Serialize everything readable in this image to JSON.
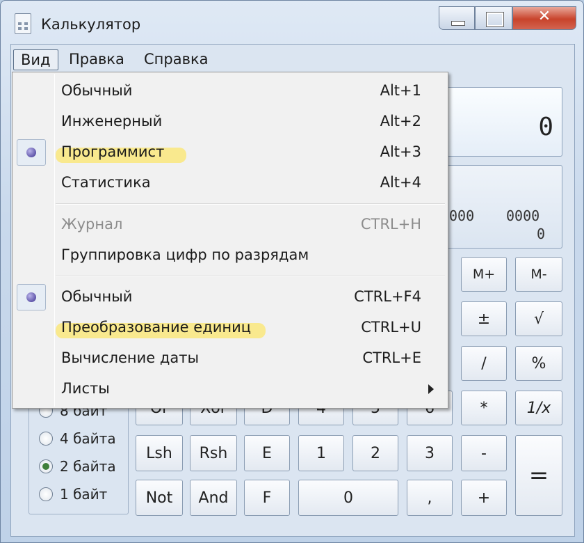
{
  "window": {
    "title": "Калькулятор"
  },
  "menubar": {
    "items": [
      "Вид",
      "Правка",
      "Справка"
    ],
    "active": "Вид"
  },
  "dropdown": {
    "groups": [
      [
        {
          "label": "Обычный",
          "shortcut": "Alt+1",
          "checked": false,
          "disabled": false
        },
        {
          "label": "Инженерный",
          "shortcut": "Alt+2",
          "checked": false,
          "disabled": false
        },
        {
          "label": "Программист",
          "shortcut": "Alt+3",
          "checked": true,
          "disabled": false,
          "highlighted": true
        },
        {
          "label": "Статистика",
          "shortcut": "Alt+4",
          "checked": false,
          "disabled": false
        }
      ],
      [
        {
          "label": "Журнал",
          "shortcut": "CTRL+H",
          "checked": false,
          "disabled": true
        },
        {
          "label": "Группировка цифр по разрядам",
          "shortcut": "",
          "checked": false,
          "disabled": false
        }
      ],
      [
        {
          "label": "Обычный",
          "shortcut": "CTRL+F4",
          "checked": true,
          "disabled": false
        },
        {
          "label": "Преобразование единиц",
          "shortcut": "CTRL+U",
          "checked": false,
          "disabled": false,
          "highlighted": true
        },
        {
          "label": "Вычисление даты",
          "shortcut": "CTRL+E",
          "checked": false,
          "disabled": false
        },
        {
          "label": "Листы",
          "shortcut": "",
          "checked": false,
          "disabled": false,
          "submenu": true
        }
      ]
    ]
  },
  "display": {
    "value": "0",
    "bits_row1": [
      "000",
      "0000"
    ],
    "bits_row2": "0"
  },
  "word_size": {
    "options": [
      "8 байт",
      "4 байта",
      "2 байта",
      "1 байт"
    ],
    "selected": "2 байта"
  },
  "keypad": {
    "visible_top_row": [
      "Or",
      "Xor",
      "D",
      "4",
      "5",
      "6",
      "*",
      "1/x"
    ],
    "memory_row": [
      "M+",
      "M-"
    ],
    "row_sign": [
      "±",
      "√"
    ],
    "row_div": [
      "/",
      "%"
    ],
    "row_lsh": [
      "Lsh",
      "Rsh",
      "E",
      "1",
      "2",
      "3",
      "-",
      "="
    ],
    "row_not": [
      "Not",
      "And",
      "F",
      "0",
      ",",
      "+"
    ]
  },
  "colors": {
    "highlight": "#ffe23c",
    "menu_background": "#f1f1f1",
    "window_background": "#dbe5f1",
    "close_button": "#c8432b"
  }
}
